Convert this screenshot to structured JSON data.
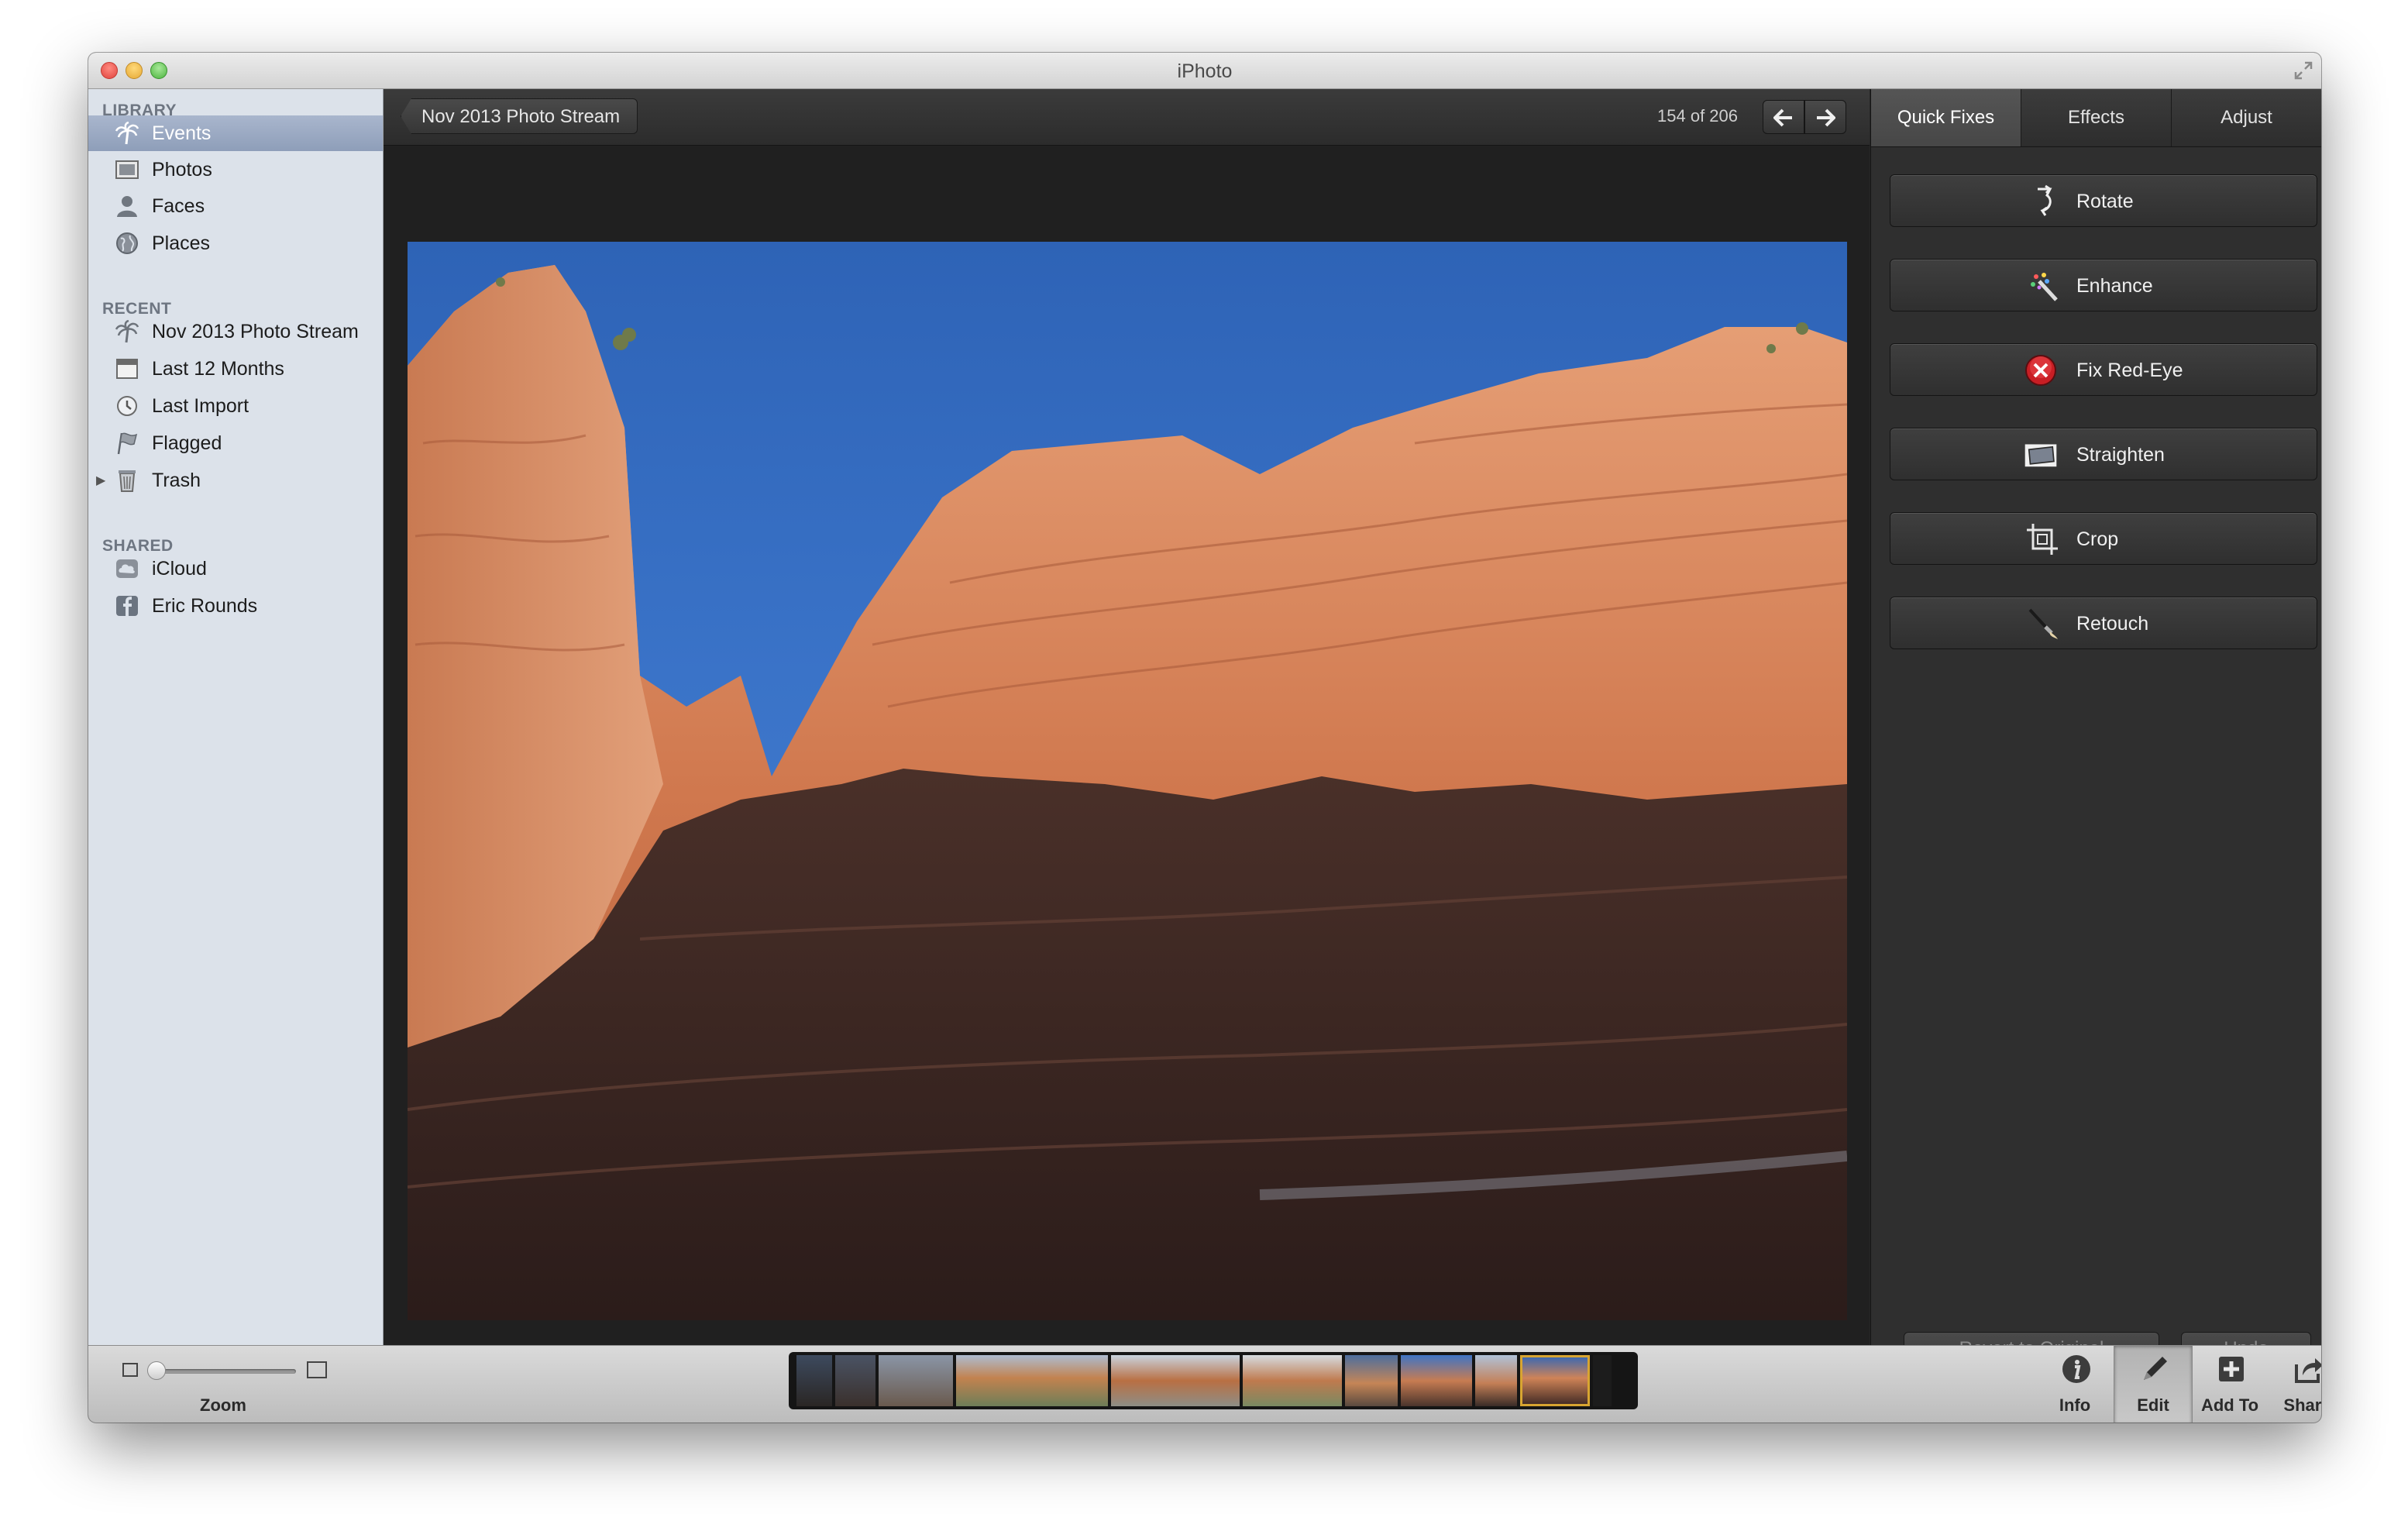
{
  "window": {
    "title": "iPhoto"
  },
  "sidebar": {
    "sections": [
      {
        "header": "LIBRARY",
        "items": [
          {
            "label": "Events",
            "icon": "palm-tree-icon",
            "selected": true
          },
          {
            "label": "Photos",
            "icon": "photo-frame-icon"
          },
          {
            "label": "Faces",
            "icon": "person-icon"
          },
          {
            "label": "Places",
            "icon": "globe-icon"
          }
        ]
      },
      {
        "header": "RECENT",
        "items": [
          {
            "label": "Nov 2013 Photo Stream",
            "icon": "palm-tree-icon"
          },
          {
            "label": "Last 12 Months",
            "icon": "calendar-icon"
          },
          {
            "label": "Last Import",
            "icon": "clock-icon"
          },
          {
            "label": "Flagged",
            "icon": "flag-icon"
          },
          {
            "label": "Trash",
            "icon": "trash-icon"
          }
        ]
      },
      {
        "header": "SHARED",
        "items": [
          {
            "label": "iCloud",
            "icon": "cloud-icon"
          },
          {
            "label": "Eric Rounds",
            "icon": "facebook-icon"
          }
        ]
      }
    ]
  },
  "viewer": {
    "back_label": "Nov 2013 Photo Stream",
    "counter": "154 of 206"
  },
  "panel": {
    "tabs": [
      "Quick Fixes",
      "Effects",
      "Adjust"
    ],
    "active_tab": "Quick Fixes",
    "fixes": [
      {
        "label": "Rotate",
        "icon": "rotate-icon"
      },
      {
        "label": "Enhance",
        "icon": "magic-wand-icon"
      },
      {
        "label": "Fix Red-Eye",
        "icon": "red-eye-icon"
      },
      {
        "label": "Straighten",
        "icon": "straighten-icon"
      },
      {
        "label": "Crop",
        "icon": "crop-icon"
      },
      {
        "label": "Retouch",
        "icon": "brush-icon"
      }
    ],
    "revert_label": "Revert to Original",
    "undo_label": "Undo"
  },
  "bottombar": {
    "zoom_label": "Zoom",
    "zoom_level": 0.0,
    "buttons": [
      {
        "label": "Info",
        "icon": "info-icon"
      },
      {
        "label": "Edit",
        "icon": "pencil-icon",
        "active": true
      },
      {
        "label": "Add To",
        "icon": "plus-icon"
      },
      {
        "label": "Share",
        "icon": "share-icon"
      }
    ]
  },
  "colors": {
    "selection": "#8e9eb9",
    "filmstrip_highlight": "#d8a531",
    "sky": "#3a73c8"
  }
}
